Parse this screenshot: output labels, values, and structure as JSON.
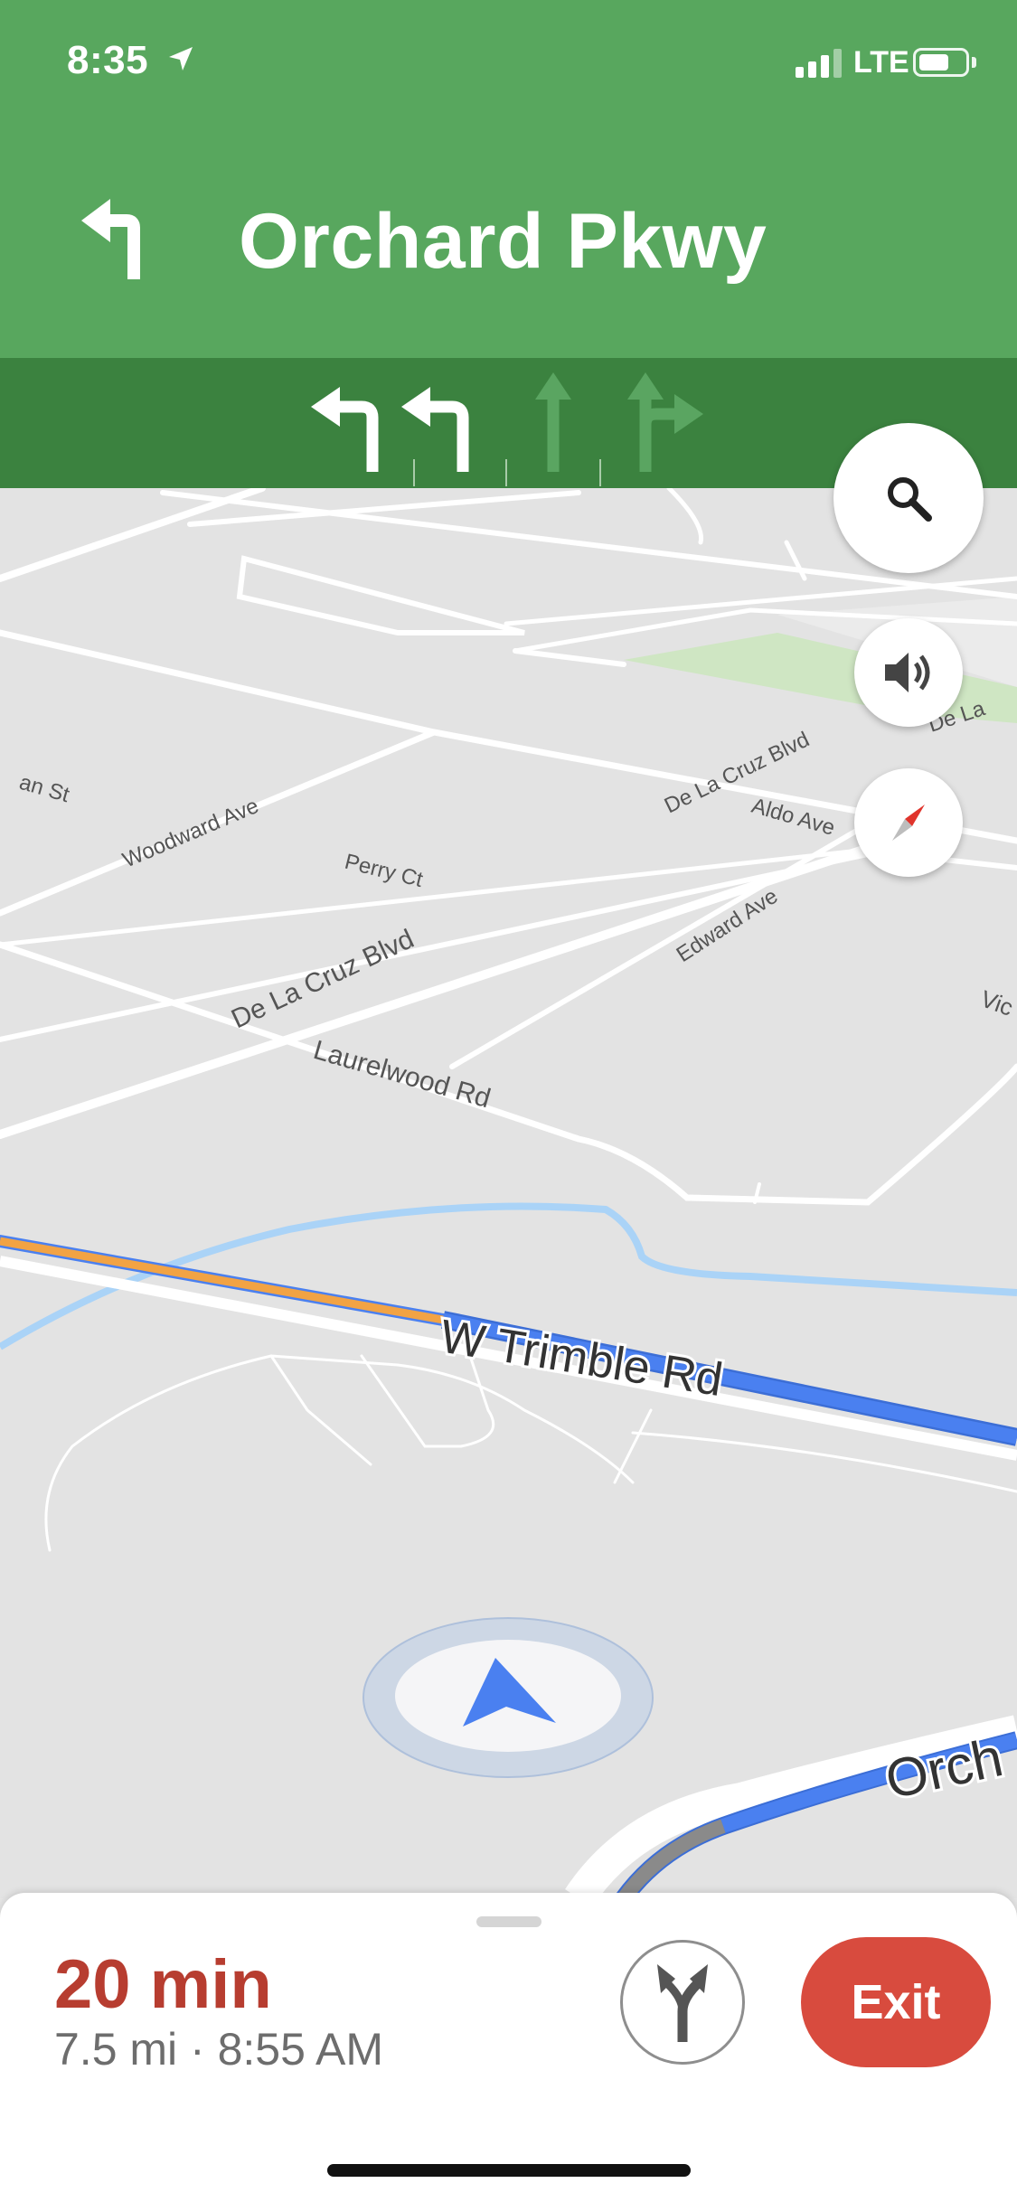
{
  "status_bar": {
    "time": "8:35",
    "network": "LTE"
  },
  "navigation": {
    "street_name": "Orchard Pkwy",
    "maneuver_icon": "turn-left-icon",
    "lanes": [
      {
        "icon": "turn-left-lane-icon",
        "recommended": true
      },
      {
        "icon": "turn-left-lane-icon",
        "recommended": true
      },
      {
        "icon": "straight-lane-icon",
        "recommended": false
      },
      {
        "icon": "straight-or-right-lane-icon",
        "recommended": false
      }
    ]
  },
  "map": {
    "labels": {
      "woodward": "Woodward Ave",
      "perry": "Perry Ct",
      "delacruz_main": "De La Cruz Blvd",
      "delacruz_top": "De La Cruz Blvd",
      "delacruz_edge": "De La",
      "aldo": "Aldo Ave",
      "edward": "Edward Ave",
      "laurelwood": "Laurelwood Rd",
      "trimble": "W Trimble Rd",
      "orchard": "Orch",
      "partial_left": "an St",
      "partial_right": "Vic"
    }
  },
  "controls": {
    "search": "search-icon",
    "sound": "volume-icon",
    "compass": "compass-icon"
  },
  "trip": {
    "duration_value": "20",
    "duration_unit": "min",
    "distance_arrival": "7.5 mi · 8:55 AM",
    "exit_label": "Exit"
  },
  "colors": {
    "header_green": "#58a75e",
    "lane_bar_green": "#3b823f",
    "route_blue": "#4a80f0",
    "route_traffic_orange": "#f2a344",
    "eta_red": "#b73d30",
    "exit_button_red": "#d84b3e"
  }
}
